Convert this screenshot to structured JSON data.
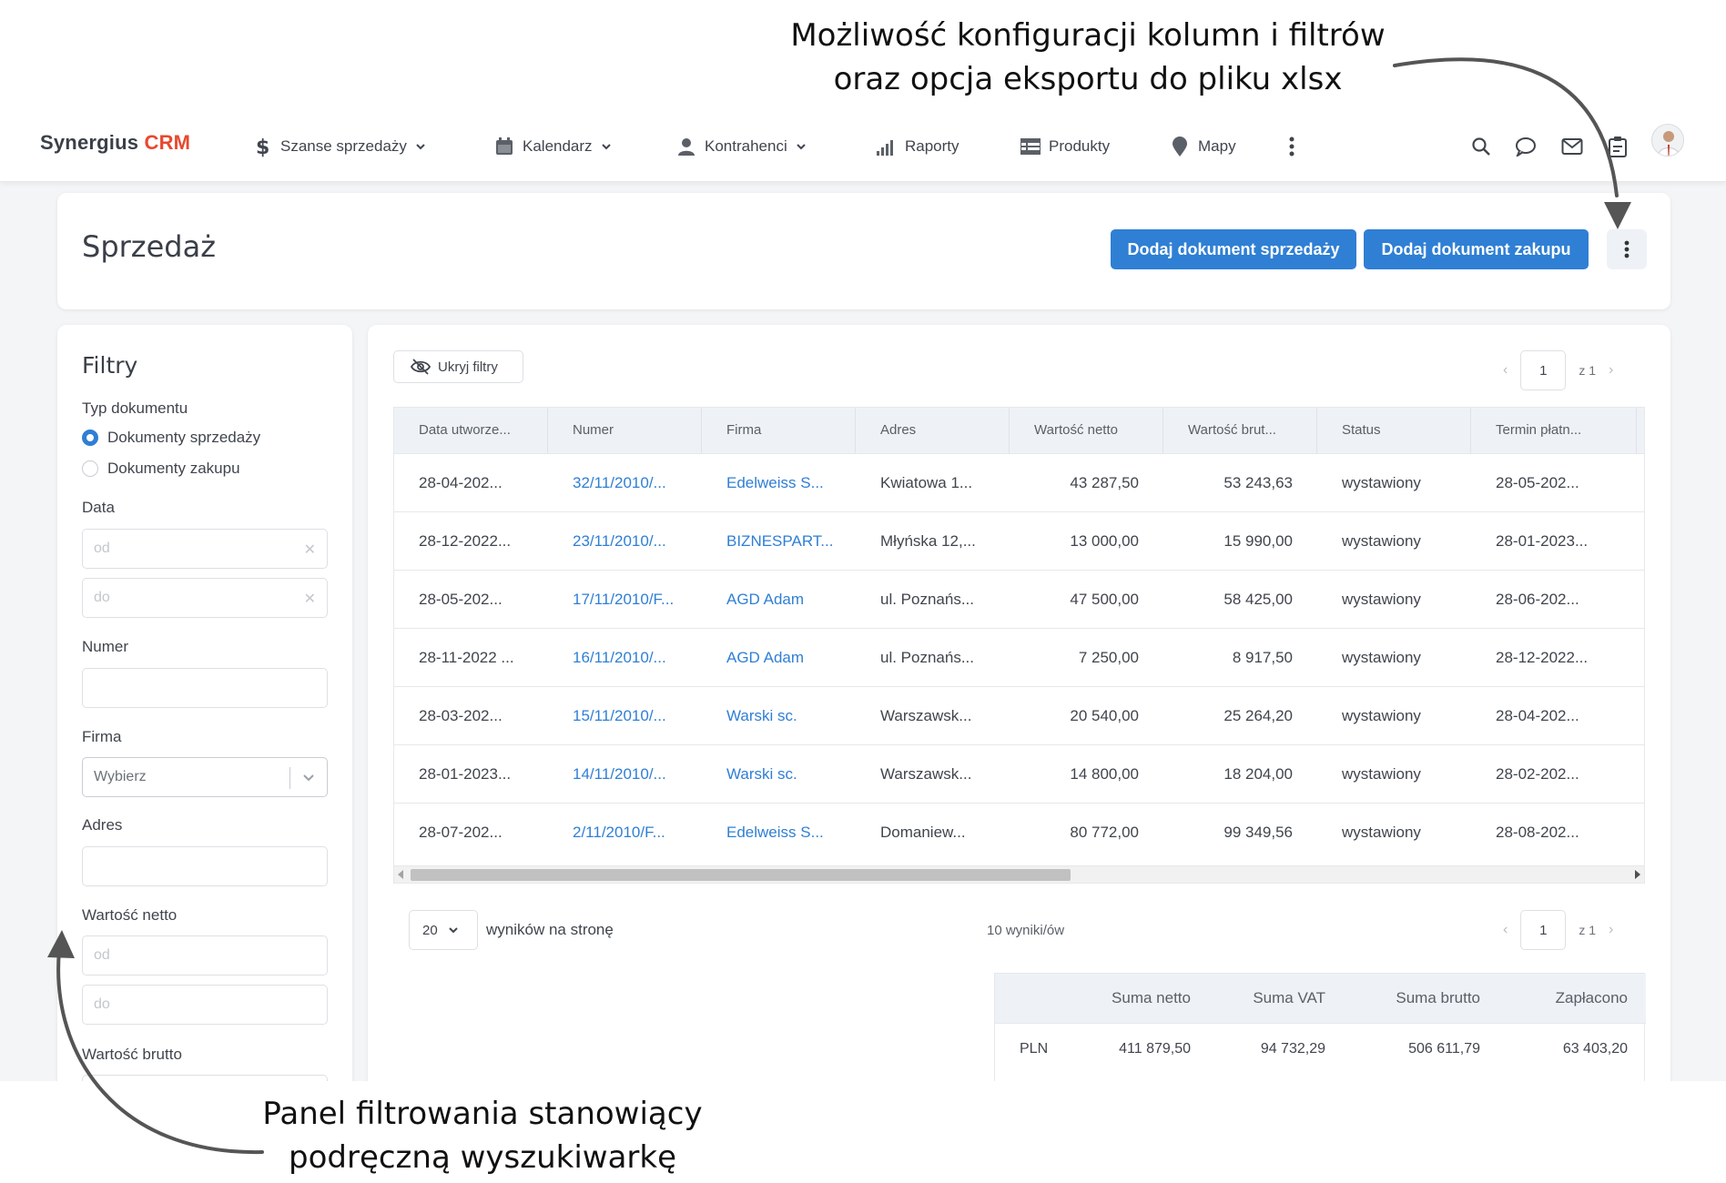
{
  "annotations": {
    "top_line1": "Możliwość konfiguracji kolumn i filtrów",
    "top_line2": "oraz opcja eksportu do pliku xlsx",
    "bottom_line1": "Panel filtrowania stanowiący",
    "bottom_line2": "podręczną wyszukiwarkę"
  },
  "navbar": {
    "logo_main": "Synergius",
    "logo_accent": "CRM",
    "items": [
      {
        "label": "Szanse sprzedaży",
        "icon": "dollar-icon",
        "dropdown": true
      },
      {
        "label": "Kalendarz",
        "icon": "calendar-icon",
        "dropdown": true
      },
      {
        "label": "Kontrahenci",
        "icon": "person-icon",
        "dropdown": true
      },
      {
        "label": "Raporty",
        "icon": "signal-bars-icon",
        "dropdown": false
      },
      {
        "label": "Produkty",
        "icon": "table-list-icon",
        "dropdown": false
      },
      {
        "label": "Mapy",
        "icon": "map-pin-icon",
        "dropdown": false
      }
    ],
    "right_icons": [
      "search-icon",
      "chat-icon",
      "mail-icon",
      "clipboard-icon"
    ]
  },
  "header": {
    "title": "Sprzedaż",
    "btn_add_sale": "Dodaj dokument sprzedaży",
    "btn_add_purchase": "Dodaj dokument zakupu"
  },
  "filters": {
    "title": "Filtry",
    "doc_type_label": "Typ dokumentu",
    "doc_type_options": [
      "Dokumenty sprzedaży",
      "Dokumenty zakupu"
    ],
    "doc_type_selected": "Dokumenty sprzedaży",
    "date_label": "Data",
    "date_from_placeholder": "od",
    "date_to_placeholder": "do",
    "number_label": "Numer",
    "company_label": "Firma",
    "company_placeholder": "Wybierz",
    "address_label": "Adres",
    "net_label": "Wartość netto",
    "net_from_placeholder": "od",
    "net_to_placeholder": "do",
    "gross_label": "Wartość brutto"
  },
  "list": {
    "hide_filters": "Ukryj filtry",
    "page_current": "1",
    "page_of": "z 1",
    "columns": [
      "Data utworze...",
      "Numer",
      "Firma",
      "Adres",
      "Wartość netto",
      "Wartość brut...",
      "Status",
      "Termin płatn..."
    ],
    "rows": [
      [
        "28-04-202...",
        "32/11/2010/...",
        "Edelweiss S...",
        "Kwiatowa 1...",
        "43 287,50",
        "53 243,63",
        "wystawiony",
        "28-05-202..."
      ],
      [
        "28-12-2022...",
        "23/11/2010/...",
        "BIZNESPART...",
        "Młyńska 12,...",
        "13 000,00",
        "15 990,00",
        "wystawiony",
        "28-01-2023..."
      ],
      [
        "28-05-202...",
        "17/11/2010/F...",
        "AGD Adam",
        "ul. Poznańs...",
        "47 500,00",
        "58 425,00",
        "wystawiony",
        "28-06-202..."
      ],
      [
        "28-11-2022 ...",
        "16/11/2010/...",
        "AGD Adam",
        "ul. Poznańs...",
        "7 250,00",
        "8 917,50",
        "wystawiony",
        "28-12-2022..."
      ],
      [
        "28-03-202...",
        "15/11/2010/...",
        "Warski sc.",
        "Warszawsk...",
        "20 540,00",
        "25 264,20",
        "wystawiony",
        "28-04-202..."
      ],
      [
        "28-01-2023...",
        "14/11/2010/...",
        "Warski sc.",
        "Warszawsk...",
        "14 800,00",
        "18 204,00",
        "wystawiony",
        "28-02-202..."
      ],
      [
        "28-07-202...",
        "2/11/2010/F...",
        "Edelweiss S...",
        "Domaniew...",
        "80 772,00",
        "99 349,56",
        "wystawiony",
        "28-08-202..."
      ]
    ],
    "per_page": "20",
    "per_page_label": "wyników na stronę",
    "results_count": "10 wyniki/ów"
  },
  "summary": {
    "headers": [
      "Suma netto",
      "Suma VAT",
      "Suma brutto",
      "Zapłacono"
    ],
    "row": [
      "PLN",
      "411 879,50",
      "94 732,29",
      "506 611,79",
      "63 403,20"
    ]
  },
  "colors": {
    "primary": "#2f7fd4",
    "logo_accent": "#e8482f",
    "link": "#2f7fd4",
    "background": "#f4f5f7"
  }
}
